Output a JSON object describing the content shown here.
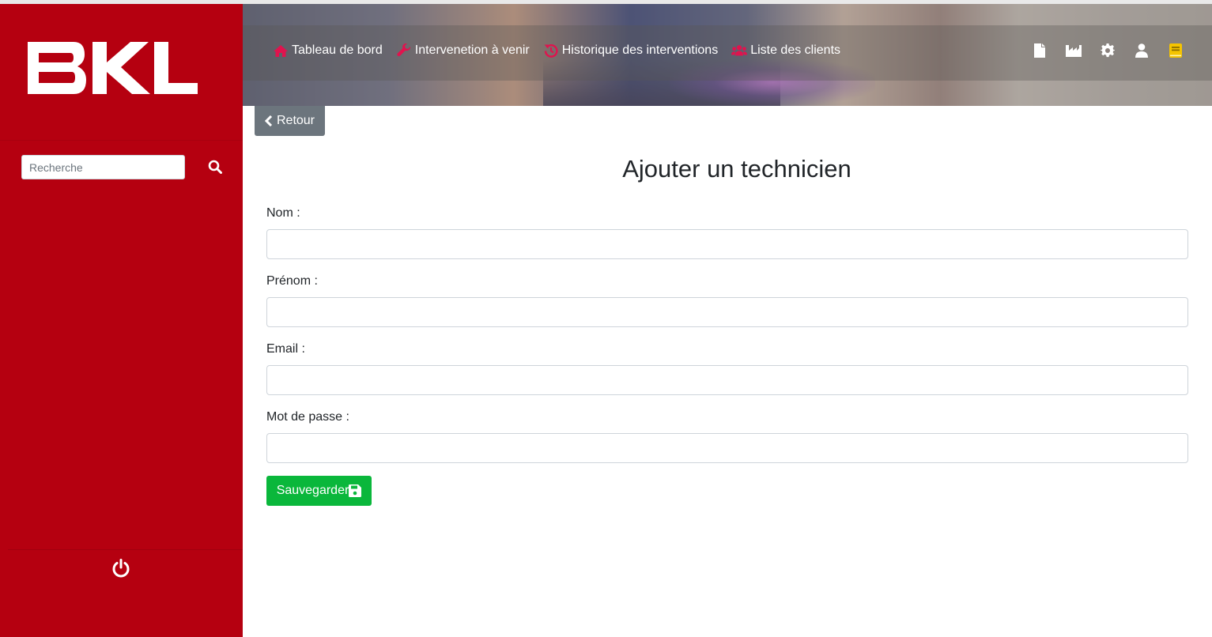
{
  "brand": {
    "logo_text": "BKL",
    "sidebar_color": "#b50010"
  },
  "sidebar": {
    "search": {
      "placeholder": "Recherche",
      "value": ""
    }
  },
  "nav": {
    "items": [
      {
        "label": "Tableau de bord",
        "icon": "home-icon"
      },
      {
        "label": "Intervenetion à venir",
        "icon": "wrench-icon"
      },
      {
        "label": "Historique des interventions",
        "icon": "history-icon"
      },
      {
        "label": "Liste des clients",
        "icon": "users-icon"
      }
    ],
    "icon_color": "#e0134e",
    "right_icons": [
      "file-icon",
      "industry-icon",
      "gear-icon",
      "user-icon",
      "book-icon"
    ]
  },
  "main": {
    "back_label": "Retour",
    "title": "Ajouter un technicien",
    "fields": [
      {
        "label": "Nom :",
        "value": ""
      },
      {
        "label": "Prénom :",
        "value": ""
      },
      {
        "label": "Email :",
        "value": ""
      },
      {
        "label": "Mot de passe :",
        "value": ""
      }
    ],
    "save_label": "Sauvegarder",
    "save_color": "#0ab73b"
  }
}
